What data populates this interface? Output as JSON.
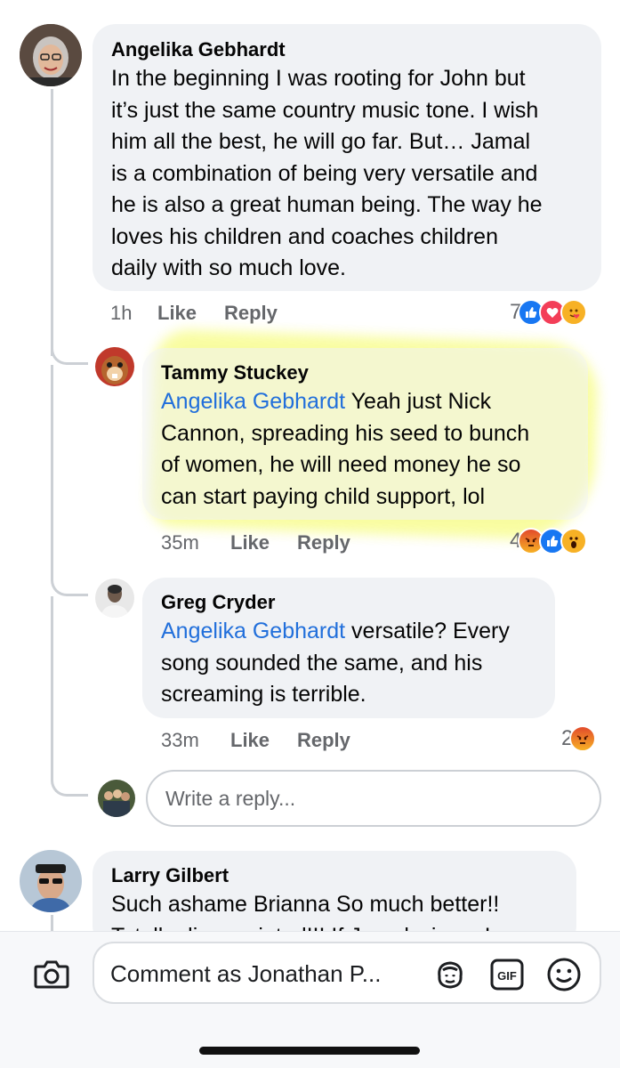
{
  "comments": [
    {
      "author": "Angelika Gebhardt",
      "lines": [
        "In the beginning I was rooting for John but",
        "it’s just the same country music tone. I wish",
        "him all the best, he will go far. But… Jamal",
        "is a combination of being very versatile and",
        "he is also a great human being. The way he",
        "loves his children and coaches children",
        "daily with so much love."
      ],
      "time": "1h",
      "like_label": "Like",
      "reply_label": "Reply",
      "reaction_count": "7",
      "reactions": [
        "like-icon",
        "love-icon",
        "care-icon"
      ]
    },
    {
      "author": "Tammy Stuckey",
      "mention": "Angelika Gebhardt",
      "lines": [
        " Yeah just Nick",
        "Cannon,  spreading his seed to bunch",
        "of women,  he will need money he so",
        "can start paying child support,  lol"
      ],
      "time": "35m",
      "like_label": "Like",
      "reply_label": "Reply",
      "reaction_count": "4",
      "reactions": [
        "angry-icon",
        "like-icon",
        "wow-icon"
      ]
    },
    {
      "author": "Greg Cryder",
      "mention": "Angelika Gebhardt",
      "lines": [
        " versatile? Every",
        "song sounded the same, and his",
        "screaming is terrible."
      ],
      "time": "33m",
      "like_label": "Like",
      "reply_label": "Reply",
      "reaction_count": "2",
      "reactions": [
        "angry-icon"
      ]
    },
    {
      "author": "Larry Gilbert",
      "lines": [
        "Such ashame Brianna So much better!!",
        "Totally disappointed!!! If Jamal wins... I am"
      ]
    }
  ],
  "write_reply_placeholder": "Write a reply...",
  "comment_placeholder": "Comment as Jonathan P...",
  "gif_label": "GIF",
  "colors": {
    "like": "#1877f2",
    "love": "#f33e58",
    "angry": "#e9710f",
    "mention": "#216fdb",
    "highlight": "#f4fb54"
  }
}
